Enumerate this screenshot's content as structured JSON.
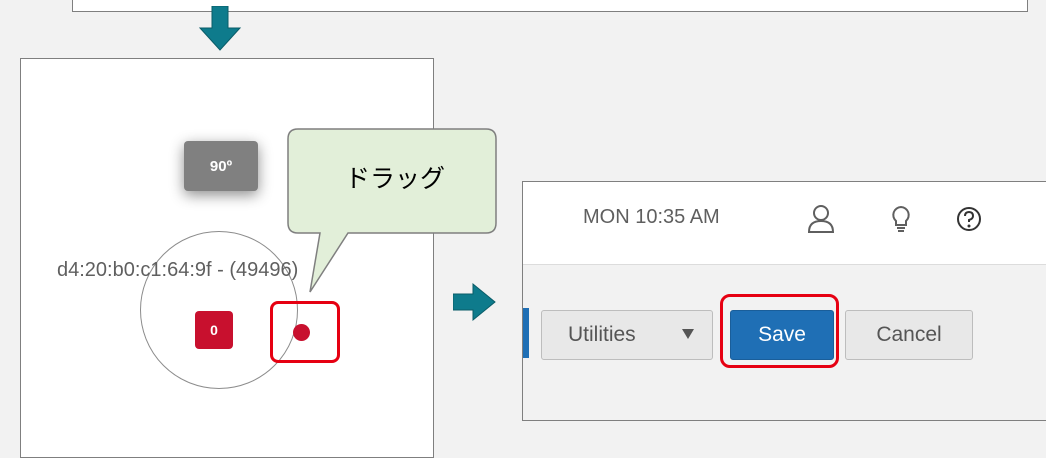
{
  "top_panel": {},
  "map": {
    "angle_label": "90º",
    "device_label": "d4:20:b0:c1:64:9f - (49496)",
    "count_badge": "0"
  },
  "callout": {
    "text": "ドラッグ"
  },
  "header": {
    "clock": "MON 10:35 AM"
  },
  "toolbar": {
    "utilities_label": "Utilities",
    "save_label": "Save",
    "cancel_label": "Cancel"
  },
  "icons": {
    "step_down": "arrow-down-icon",
    "step_right": "arrow-right-icon",
    "user": "user-icon",
    "tips": "lightbulb-icon",
    "help": "help-icon",
    "dropdown": "caret-down-icon"
  },
  "colors": {
    "step_arrow": "#0e7b8c",
    "highlight": "#e60012",
    "callout_fill": "#e2efd9",
    "badge_red": "#c8102e",
    "badge_gray": "#808080",
    "primary_button": "#1f6fb5"
  }
}
